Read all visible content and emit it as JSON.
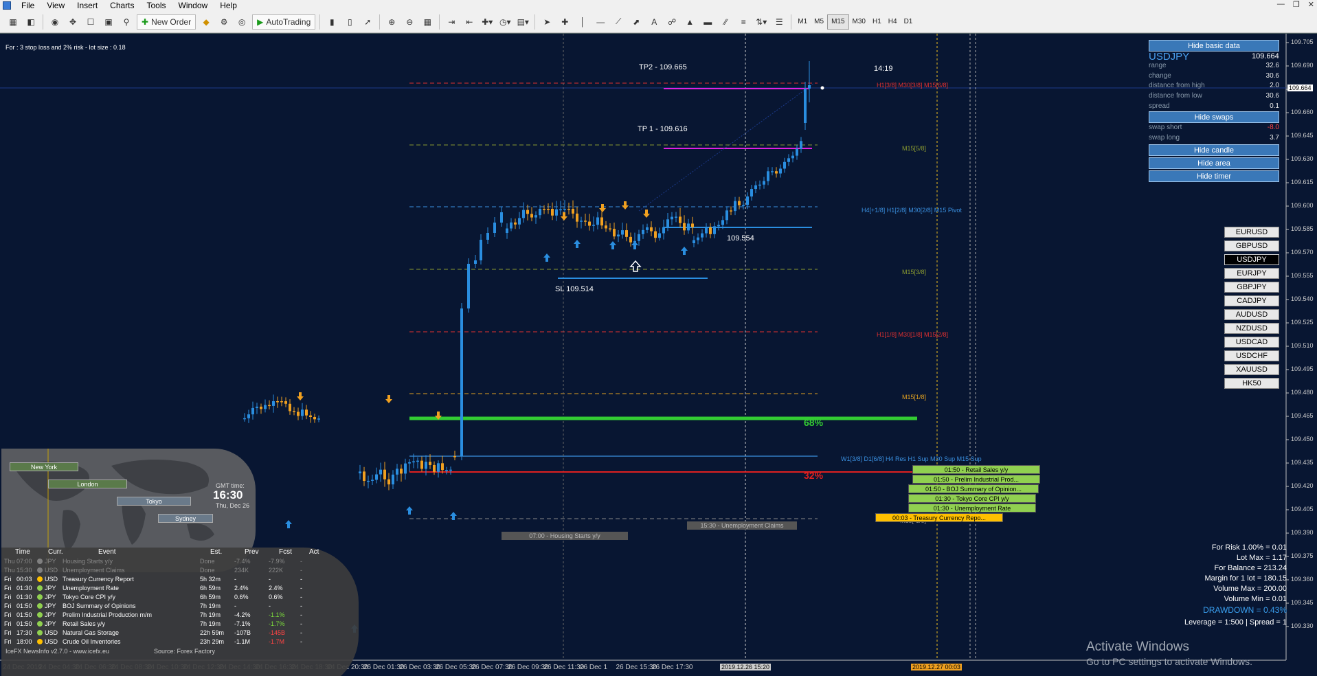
{
  "menubar": {
    "items": [
      "File",
      "View",
      "Insert",
      "Charts",
      "Tools",
      "Window",
      "Help"
    ]
  },
  "toolbar": {
    "new_order": "New Order",
    "autotrading": "AutoTrading",
    "timeframes": [
      "M1",
      "M5",
      "M15",
      "M30",
      "H1",
      "H4",
      "D1"
    ],
    "active_timeframe": "M15"
  },
  "chart": {
    "top_note": "For : 3 stop loss and 2% risk - lot size : 0.18",
    "labels": {
      "tp2": "TP2 - 109.665",
      "tp1": "TP 1 -  109.616",
      "sl": "SL 109.514",
      "entry": "109.554",
      "timer": "14:19",
      "pct_high": "68%",
      "pct_low": "32%"
    },
    "level_labels": {
      "h1_3_8": "H1[3/8] M30[3/8] M15[6/8]",
      "m15_5_8": "M15[5/8]",
      "pivot": "H4[+1/8] H1[2/8] M30[2/8] M15 Pivot",
      "m15_3_8": "M15[3/8]",
      "h1_1_8": "H1[1/8] M30[1/8] M15[2/8]",
      "m15_1_8": "M15[1/8]",
      "w1": "W1[3/8] D1[6/8] H4 Res H1 Sup M30 Sup M15 Sup",
      "m15_m1_8": "M15[-1/8]"
    },
    "current_price": "109.664",
    "price_ticks": [
      "109.705",
      "109.690",
      "109.675",
      "109.660",
      "109.645",
      "109.630",
      "109.615",
      "109.600",
      "109.585",
      "109.570",
      "109.555",
      "109.540",
      "109.525",
      "109.510",
      "109.495",
      "109.480",
      "109.465",
      "109.450",
      "109.435",
      "109.420",
      "109.405",
      "109.390",
      "109.375",
      "109.360",
      "109.345",
      "109.330"
    ],
    "time_ticks": [
      "24 Dec 2019",
      "24 Dec 04:30",
      "24 Dec 06:30",
      "24 Dec 08:30",
      "24 Dec 10:30",
      "24 Dec 12:30",
      "24 Dec 14:30",
      "24 Dec 16:30",
      "24 Dec 18:30",
      "24 Dec 20:30",
      "26 Dec 01:30",
      "26 Dec 03:30",
      "26 Dec 05:30",
      "26 Dec 07:30",
      "26 Dec 09:30",
      "26 Dec 11:30",
      "26 Dec 1",
      "26 Dec 15:30",
      "26 Dec 17:30"
    ],
    "time_marker_1": "2019.12.26 15:20",
    "time_marker_2": "2019.12.27 00:03",
    "housing_box": "07:00 - Housing Starts y/y",
    "claims_box": "15:30 - Unemployment Claims"
  },
  "info_panel": {
    "hide_basic": "Hide basic data",
    "symbol": "USDJPY",
    "bid": "109.664",
    "rows": [
      {
        "k": "range",
        "v": "32.6"
      },
      {
        "k": "change",
        "v": "30.6"
      },
      {
        "k": "distance from high",
        "v": "2.0"
      },
      {
        "k": "distance from low",
        "v": "30.6"
      },
      {
        "k": "spread",
        "v": "0.1"
      }
    ],
    "hide_swaps": "Hide swaps",
    "swaps": [
      {
        "k": "swap short",
        "v": "-8.0"
      },
      {
        "k": "swap long",
        "v": "3.7"
      }
    ],
    "hide_candle": "Hide candle",
    "hide_area": "Hide area",
    "hide_timer": "Hide timer",
    "swap_short_color": "#ff4444"
  },
  "symbols": [
    "EURUSD",
    "GBPUSD",
    "USDJPY",
    "EURJPY",
    "GBPJPY",
    "CADJPY",
    "AUDUSD",
    "NZDUSD",
    "USDCAD",
    "USDCHF",
    "XAUUSD",
    "HK50"
  ],
  "selected_symbol": "USDJPY",
  "sessions": {
    "new_york": "New York",
    "london": "London",
    "tokyo": "Tokyo",
    "sydney": "Sydney",
    "gmt_label": "GMT time:",
    "gmt_time": "16:30",
    "gmt_date": "Thu, Dec 26"
  },
  "news": {
    "headers": [
      "Time",
      "Curr.",
      "Event",
      "Est.",
      "Prev",
      "Fcst",
      "Act"
    ],
    "rows": [
      {
        "day": "Thu",
        "time": "07:00",
        "curr": "JPY",
        "event": "Housing Starts y/y",
        "est": "Done",
        "prev": "-7.4%",
        "fcst": "-7.9%",
        "act": "-",
        "past": true,
        "color": "#808080"
      },
      {
        "day": "Thu",
        "time": "15:30",
        "curr": "USD",
        "event": "Unemployment Claims",
        "est": "Done",
        "prev": "234K",
        "fcst": "222K",
        "act": "-",
        "past": true,
        "color": "#808080"
      },
      {
        "day": "Fri",
        "time": "00:03",
        "curr": "USD",
        "event": "Treasury Currency Report",
        "est": "5h 32m",
        "prev": "-",
        "fcst": "-",
        "act": "-",
        "past": false,
        "color": "#ffc000"
      },
      {
        "day": "Fri",
        "time": "01:30",
        "curr": "JPY",
        "event": "Unemployment Rate",
        "est": "6h 59m",
        "prev": "2.4%",
        "fcst": "2.4%",
        "act": "-",
        "past": false,
        "color": "#90d050"
      },
      {
        "day": "Fri",
        "time": "01:30",
        "curr": "JPY",
        "event": "Tokyo Core CPI y/y",
        "est": "6h 59m",
        "prev": "0.6%",
        "fcst": "0.6%",
        "act": "-",
        "past": false,
        "color": "#90d050"
      },
      {
        "day": "Fri",
        "time": "01:50",
        "curr": "JPY",
        "event": "BOJ Summary of Opinions",
        "est": "7h 19m",
        "prev": "-",
        "fcst": "-",
        "act": "-",
        "past": false,
        "color": "#90d050"
      },
      {
        "day": "Fri",
        "time": "01:50",
        "curr": "JPY",
        "event": "Prelim Industrial Production m/m",
        "est": "7h 19m",
        "prev": "-4.2%",
        "fcst": "-1.1%",
        "act": "-",
        "past": false,
        "color": "#90d050"
      },
      {
        "day": "Fri",
        "time": "01:50",
        "curr": "JPY",
        "event": "Retail Sales y/y",
        "est": "7h 19m",
        "prev": "-7.1%",
        "fcst": "-1.7%",
        "act": "-",
        "past": false,
        "color": "#90d050"
      },
      {
        "day": "Fri",
        "time": "17:30",
        "curr": "USD",
        "event": "Natural Gas Storage",
        "est": "22h 59m",
        "prev": "-107B",
        "fcst": "-145B",
        "act": "-",
        "past": false,
        "color": "#90d050"
      },
      {
        "day": "Fri",
        "time": "18:00",
        "curr": "USD",
        "event": "Crude Oil Inventories",
        "est": "23h 29m",
        "prev": "-1.1M",
        "fcst": "-1.7M",
        "act": "-",
        "past": false,
        "color": "#ffc000"
      }
    ],
    "footer_left": "IceFX NewsInfo v2.7.0  -  www.icefx.eu",
    "footer_right": "Source: Forex Factory"
  },
  "event_boxes": [
    {
      "text": "01:50 - Retail Sales y/y",
      "color": "#90d050"
    },
    {
      "text": "01:50 - Prelim Industrial Prod...",
      "color": "#90d050"
    },
    {
      "text": "01:50 - BOJ Summary of Opinion...",
      "color": "#90d050"
    },
    {
      "text": "01:30 - Tokyo Core CPI y/y",
      "color": "#90d050"
    },
    {
      "text": "01:30 - Unemployment Rate",
      "color": "#90d050"
    },
    {
      "text": "00:03 - Treasury Currency Repo...",
      "color": "#ffc000"
    }
  ],
  "risk": {
    "rows": [
      "For Risk 1.00% = 0.01",
      "Lot Max = 1.17",
      "For Balance = 213.24",
      "Margin for 1 lot = 180.15",
      "Volume Max = 200.00",
      "Volume Min = 0.01"
    ],
    "drawdown": "DRAWDOWN = 0.43%",
    "leverage": "Leverage = 1:500 | Spread = 1"
  },
  "activate": {
    "title": "Activate Windows",
    "subtitle": "Go to PC settings to activate Windows."
  },
  "colors": {
    "background": "#081632",
    "bull": "#2a8ee0",
    "bear": "#f0a020",
    "green_line": "#33cc33",
    "red_line": "#e02020",
    "magenta": "#e020e0",
    "info_button": "#3a78b8"
  }
}
